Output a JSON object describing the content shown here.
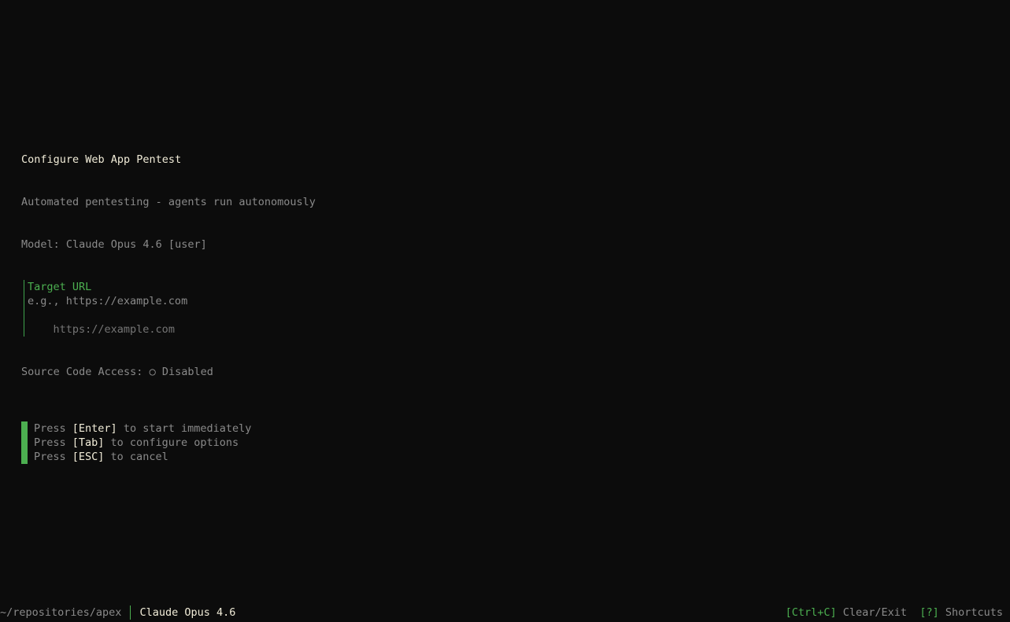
{
  "header": {
    "title": "Configure Web App Pentest",
    "subtitle": "Automated pentesting - agents run autonomously",
    "model_line": "Model: Claude Opus 4.6 [user]"
  },
  "target_field": {
    "label": "Target URL",
    "hint": "e.g., https://example.com",
    "value": "",
    "placeholder": "https://example.com"
  },
  "source_access": {
    "label": "Source Code Access: ",
    "icon": "circle-outline-icon",
    "icon_glyph": "○",
    "state": " Disabled"
  },
  "help": {
    "lines": [
      {
        "prefix": "Press ",
        "key": "[Enter]",
        "suffix": " to start immediately"
      },
      {
        "prefix": "Press ",
        "key": "[Tab]",
        "suffix": " to configure options"
      },
      {
        "prefix": "Press ",
        "key": "[ESC]",
        "suffix": " to cancel"
      }
    ]
  },
  "statusbar": {
    "path": "~/repositories/apex",
    "model": "Claude Opus 4.6",
    "shortcuts": [
      {
        "key": "[Ctrl+C]",
        "text": " Clear/Exit"
      },
      {
        "key": "[?]",
        "text": " Shortcuts"
      }
    ]
  },
  "colors": {
    "background": "#0c0c0c",
    "accent": "#4caf50",
    "heading": "#f1ecd8",
    "muted": "#8a8a8a"
  }
}
